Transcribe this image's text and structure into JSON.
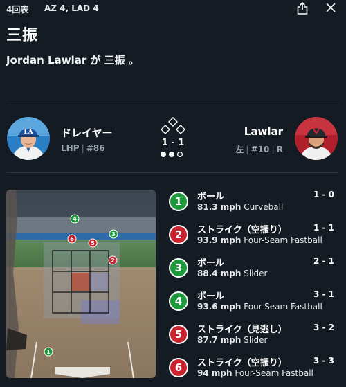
{
  "header": {
    "inning": "4回表",
    "score": "AZ 4, LAD 4"
  },
  "play": {
    "title": "三振",
    "description": "Jordan Lawlar が 三振 。"
  },
  "pitcher": {
    "name": "ドレイヤー",
    "hand": "LHP",
    "number": "#86"
  },
  "batter": {
    "name": "Lawlar",
    "side": "左",
    "number": "#10",
    "bats": "R"
  },
  "situation": {
    "count": "1 - 1",
    "outs": 2,
    "bases_occupied": []
  },
  "colors": {
    "ball": "#1e9a3c",
    "strike": "#c8232f",
    "background": "#141b22"
  },
  "pitches": [
    {
      "num": "1",
      "result": "ボール",
      "count": "1 - 0",
      "speed": "81.3 mph",
      "type": "Curveball",
      "kind": "ball"
    },
    {
      "num": "2",
      "result": "ストライク（空振り）",
      "count": "1 - 1",
      "speed": "93.9 mph",
      "type": "Four-Seam Fastball",
      "kind": "strike"
    },
    {
      "num": "3",
      "result": "ボール",
      "count": "2 - 1",
      "speed": "88.4 mph",
      "type": "Slider",
      "kind": "ball"
    },
    {
      "num": "4",
      "result": "ボール",
      "count": "3 - 1",
      "speed": "93.6 mph",
      "type": "Four-Seam Fastball",
      "kind": "ball"
    },
    {
      "num": "5",
      "result": "ストライク（見逃し）",
      "count": "3 - 2",
      "speed": "87.7 mph",
      "type": "Slider",
      "kind": "strike"
    },
    {
      "num": "6",
      "result": "ストライク（空振り）",
      "count": "3 - 3",
      "speed": "94 mph",
      "type": "Four-Seam Fastball",
      "kind": "strike"
    }
  ],
  "icons": {
    "share": "share-icon",
    "close": "close-icon"
  }
}
